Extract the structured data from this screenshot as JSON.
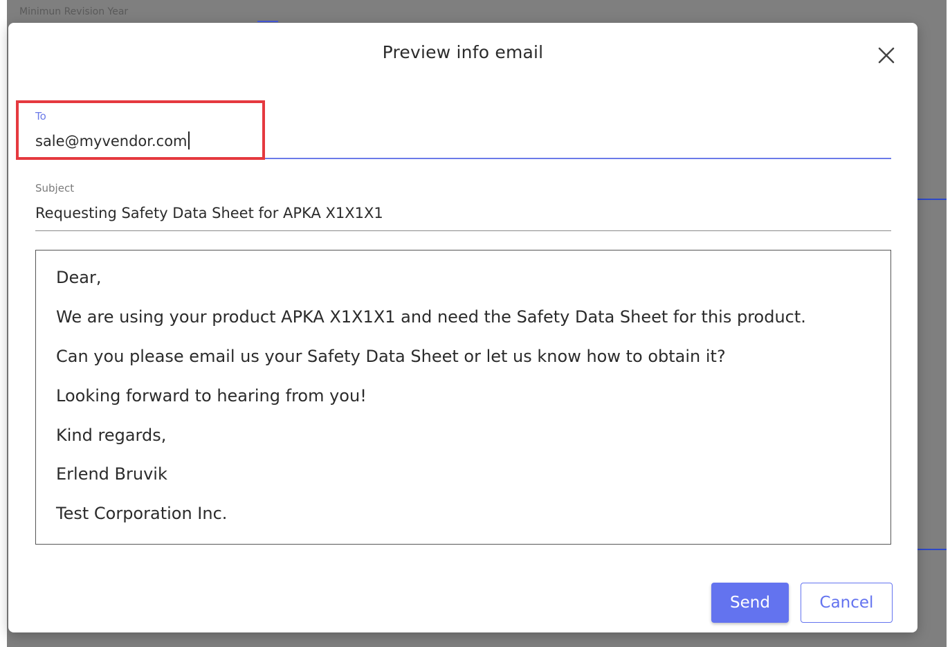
{
  "background": {
    "field_label": "Minimun Revision Year"
  },
  "dialog": {
    "title": "Preview info email",
    "close_icon": "close-icon"
  },
  "to_field": {
    "label": "To",
    "value": "sale@myvendor.com"
  },
  "subject_field": {
    "label": "Subject",
    "value": "Requesting Safety Data Sheet for APKA X1X1X1"
  },
  "email_body": {
    "lines": [
      "Dear,",
      "We are using your product APKA X1X1X1 and need the Safety Data Sheet for this product.",
      "Can you please email us your Safety Data Sheet or let us know how to obtain it?",
      "Looking forward to hearing from you!",
      "Kind regards,",
      "Erlend Bruvik",
      "Test Corporation Inc."
    ]
  },
  "actions": {
    "send_label": "Send",
    "cancel_label": "Cancel"
  },
  "colors": {
    "accent": "#6373ef",
    "highlight": "#e5393f",
    "backdrop": "#7f7f7f"
  }
}
